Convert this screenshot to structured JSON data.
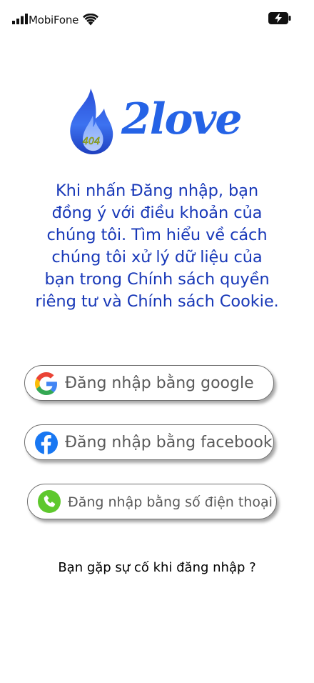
{
  "status_bar": {
    "carrier": "MobiFone"
  },
  "logo": {
    "badge_text": "404",
    "wordmark": "2love",
    "brand_color": "#2563e6"
  },
  "terms": {
    "text": "Khi nhấn Đăng nhập, bạn\nđồng ý với  điều khoản của\nchúng tôi. Tìm hiểu về cách\nchúng tôi xử lý dữ liệu của\nbạn trong Chính sách quyền\nriêng tư và Chính sách Cookie."
  },
  "buttons": {
    "google": {
      "label": "Đăng nhập bằng google",
      "icon": "google-icon"
    },
    "facebook": {
      "label": "Đăng nhập bằng facebook",
      "icon": "facebook-icon"
    },
    "phone": {
      "label": "Đăng nhập bằng số điện thoại",
      "icon": "phone-icon"
    }
  },
  "help": {
    "text": "Bạn gặp sự cố khi đăng nhập ?"
  },
  "colors": {
    "terms_text": "#1838b8",
    "facebook_blue": "#1877f2",
    "phone_green": "#5ec82d"
  }
}
